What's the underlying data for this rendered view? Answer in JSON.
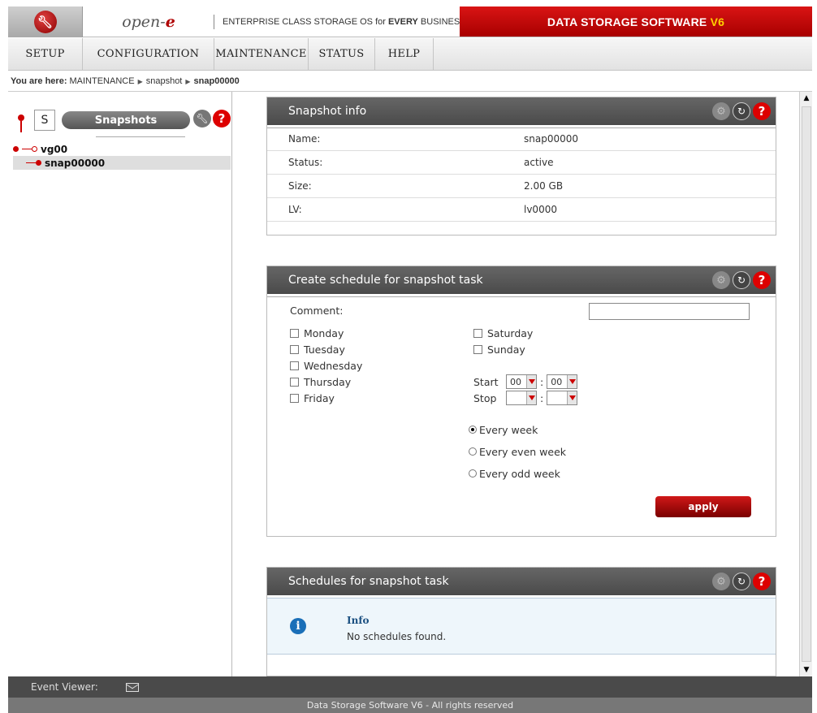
{
  "header": {
    "brand_text": "open-",
    "brand_e": "e",
    "tagline_prefix": "ENTERPRISE CLASS STORAGE OS for ",
    "tagline_bold": "EVERY",
    "tagline_suffix": " BUSINESS",
    "product_text": "DATA STORAGE SOFTWARE ",
    "product_version": "V6"
  },
  "nav": {
    "items": [
      "SETUP",
      "CONFIGURATION",
      "MAINTENANCE",
      "STATUS",
      "HELP"
    ]
  },
  "breadcrumb": {
    "label": "You are here:",
    "items": [
      "MAINTENANCE",
      "snapshot",
      "snap00000"
    ]
  },
  "left": {
    "s_label": "S",
    "tab_label": "Snapshots",
    "tree": [
      {
        "label": "vg00"
      },
      {
        "label": "snap00000"
      }
    ]
  },
  "snapshot_info": {
    "title": "Snapshot info",
    "rows": [
      {
        "key": "Name:",
        "value": "snap00000"
      },
      {
        "key": "Status:",
        "value": "active"
      },
      {
        "key": "Size:",
        "value": "2.00 GB"
      },
      {
        "key": "LV:",
        "value": "lv0000"
      }
    ]
  },
  "schedule": {
    "title": "Create schedule for snapshot task",
    "comment_label": "Comment:",
    "comment_value": "",
    "days_left": [
      "Monday",
      "Tuesday",
      "Wednesday",
      "Thursday",
      "Friday"
    ],
    "days_right": [
      "Saturday",
      "Sunday"
    ],
    "start_label": "Start",
    "stop_label": "Stop",
    "start_hour": "00",
    "start_min": "00",
    "stop_hour": "",
    "stop_min": "",
    "time_sep": ":",
    "frequency": [
      "Every week",
      "Every even week",
      "Every odd week"
    ],
    "selected_frequency": "Every week",
    "apply_label": "apply"
  },
  "schedules_list": {
    "title": "Schedules for snapshot task",
    "info_title": "Info",
    "info_text": "No schedules found."
  },
  "footer": {
    "event_viewer": "Event Viewer:",
    "copyright": "Data Storage Software V6 - All rights reserved"
  },
  "colors": {
    "brand_red": "#c00000",
    "header_grey": "#555555",
    "info_blue": "#1a6fb8"
  }
}
